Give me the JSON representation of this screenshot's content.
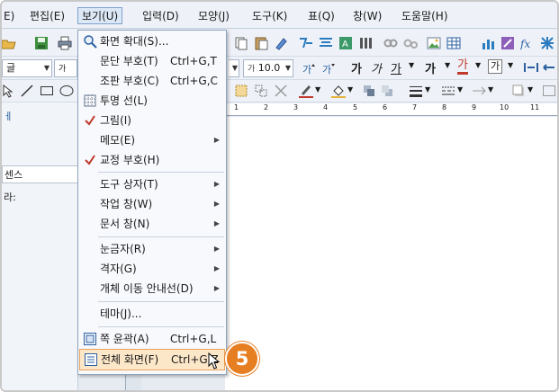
{
  "menubar": {
    "items": [
      {
        "label": "E)"
      },
      {
        "label": "편집(E)"
      },
      {
        "label": "보기(U)"
      },
      {
        "label": "입력(D)"
      },
      {
        "label": "모양(J)"
      },
      {
        "label": "도구(K)"
      },
      {
        "label": "표(Q)"
      },
      {
        "label": "창(W)"
      },
      {
        "label": "도움말(H)"
      }
    ]
  },
  "toolbar": {
    "font_name": "글",
    "font_size_prefix": "가",
    "font_size": "10.0",
    "bold": "가",
    "italic": "가",
    "underline": "가",
    "strike": "가",
    "color_text": "가",
    "box_text": "가"
  },
  "left_panel": {
    "row1": "ㅔ",
    "row2": "센스",
    "row3": "라:"
  },
  "ruler": {
    "ticks": [
      "1",
      "2",
      "3",
      "4",
      "5",
      "6",
      "7",
      "8",
      "9",
      "10",
      "11"
    ]
  },
  "view_menu": {
    "items": [
      {
        "label": "화면 확대(S)...",
        "shortcut": "",
        "icon": "zoom-icon"
      },
      {
        "label": "문단 부호(T)",
        "shortcut": "Ctrl+G,T"
      },
      {
        "label": "조판 부호(C)",
        "shortcut": "Ctrl+G,C"
      },
      {
        "label": "투명 선(L)",
        "shortcut": "",
        "icon": "grid-icon"
      },
      {
        "label": "그림(I)",
        "shortcut": "",
        "checked": true
      },
      {
        "label": "메모(E)",
        "shortcut": "",
        "submenu": true
      },
      {
        "label": "교정 부호(H)",
        "shortcut": "",
        "checked": true
      },
      {
        "label": "도구 상자(T)",
        "shortcut": "",
        "submenu": true
      },
      {
        "label": "작업 창(W)",
        "shortcut": "",
        "submenu": true
      },
      {
        "label": "문서 창(N)",
        "shortcut": "",
        "submenu": true
      },
      {
        "label": "눈금자(R)",
        "shortcut": "",
        "submenu": true
      },
      {
        "label": "격자(G)",
        "shortcut": "",
        "submenu": true
      },
      {
        "label": "개체 이동 안내선(D)",
        "shortcut": "",
        "submenu": true
      },
      {
        "label": "테마(J)...",
        "shortcut": ""
      },
      {
        "label": "쪽 윤곽(A)",
        "shortcut": "Ctrl+G,L",
        "icon": "page-outline-icon"
      },
      {
        "label": "전체 화면(F)",
        "shortcut": "Ctrl+G,Z",
        "icon": "fullscreen-icon",
        "highlighted": true
      }
    ]
  },
  "step_badge": "5",
  "colors": {
    "accent_orange": "#e67e22",
    "highlight_bg": "#fde7c9",
    "menu_border": "#8ea3bd",
    "check_red": "#c0392b"
  }
}
